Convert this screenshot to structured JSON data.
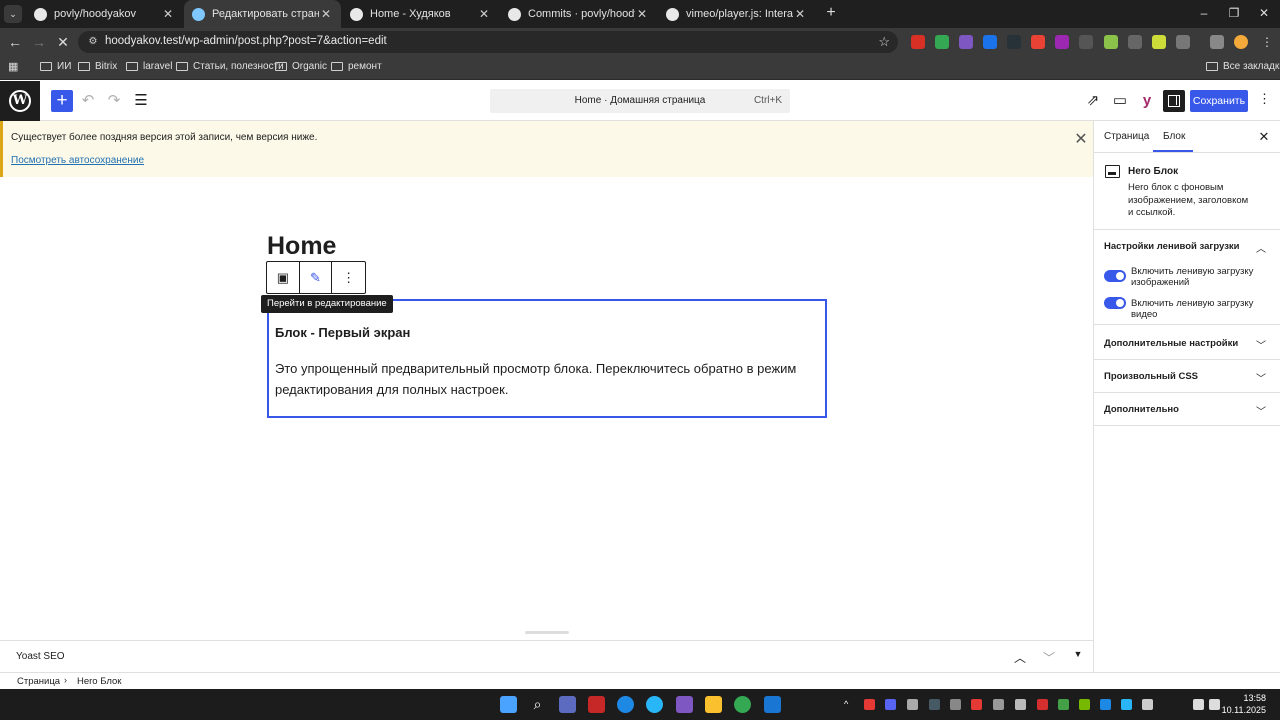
{
  "browser": {
    "tabs": [
      {
        "title": "povly/hoodyakov",
        "favicon_color": "#e8e8e8",
        "active": false
      },
      {
        "title": "Редактировать страницу “Home”",
        "favicon_color": "#7ec8ff",
        "active": true
      },
      {
        "title": "Home - Худяков",
        "favicon_color": "#e8e8e8",
        "active": false
      },
      {
        "title": "Commits · povly/hoodyakov",
        "favicon_color": "#e8e8e8",
        "active": false
      },
      {
        "title": "vimeo/player.js: Interact with an",
        "favicon_color": "#e8e8e8",
        "active": false
      }
    ],
    "url": "hoodyakov.test/wp-admin/post.php?post=7&action=edit",
    "bookmarks": [
      "ИИ",
      "Bitrix",
      "laravel",
      "Статьи, полезности",
      "Organic",
      "ремонт"
    ],
    "all_bookmarks": "Все закладки"
  },
  "editor": {
    "command_title": "Home · Домашняя страница",
    "command_shortcut": "Ctrl+K",
    "save_label": "Сохранить",
    "notice_text": "Существует более поздняя версия этой записи, чем версия ниже.",
    "notice_link": "Посмотреть автосохранение",
    "page_title": "Home",
    "tooltip": "Перейти в редактирование",
    "preview_title": "Блок - Первый экран",
    "preview_text": "Это упрощенный предварительный просмотр блока. Переключитесь обратно в режим редактирования для полных настроек."
  },
  "sidebar": {
    "tab_page": "Страница",
    "tab_block": "Блок",
    "block_name": "Hero Блок",
    "block_desc": "Hero блок с фоновым изображением, заголовком и ссылкой.",
    "lazy_panel": "Настройки ленивой загрузки",
    "toggle_images": "Включить ленивую загрузку изображений",
    "toggle_video": "Включить ленивую загрузку видео",
    "panel_extra_settings": "Дополнительные настройки",
    "panel_css": "Произвольный CSS",
    "panel_advanced": "Дополнительно"
  },
  "footer": {
    "yoast": "Yoast SEO",
    "crumb_page": "Страница",
    "crumb_block": "Hero Блок",
    "clock_time": "13:58",
    "clock_date": "10.11.2025"
  },
  "colors": {
    "wp_accent": "#3858e9",
    "notice_bg": "#fcf9e8",
    "browser_chrome": "#3a3a3a"
  }
}
